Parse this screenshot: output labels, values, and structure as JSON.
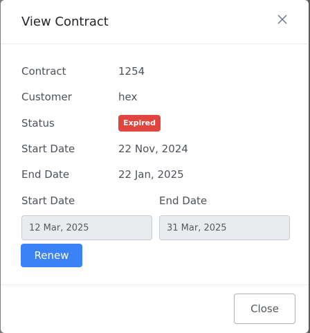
{
  "modal": {
    "title": "View Contract",
    "close_icon": "close-icon"
  },
  "details": {
    "contract": {
      "label": "Contract",
      "value": "1254"
    },
    "customer": {
      "label": "Customer",
      "value": "hex"
    },
    "status": {
      "label": "Status",
      "value": "Expired",
      "color": "#e0463d"
    },
    "start_date": {
      "label": "Start Date",
      "value": "22 Nov, 2024"
    },
    "end_date": {
      "label": "End Date",
      "value": "22 Jan, 2025"
    }
  },
  "renew_form": {
    "start_label": "Start Date",
    "start_value": "12 Mar, 2025",
    "end_label": "End Date",
    "end_value": "31 Mar, 2025",
    "renew_label": "Renew",
    "renew_color": "#3b82f6"
  },
  "footer": {
    "close_label": "Close"
  }
}
